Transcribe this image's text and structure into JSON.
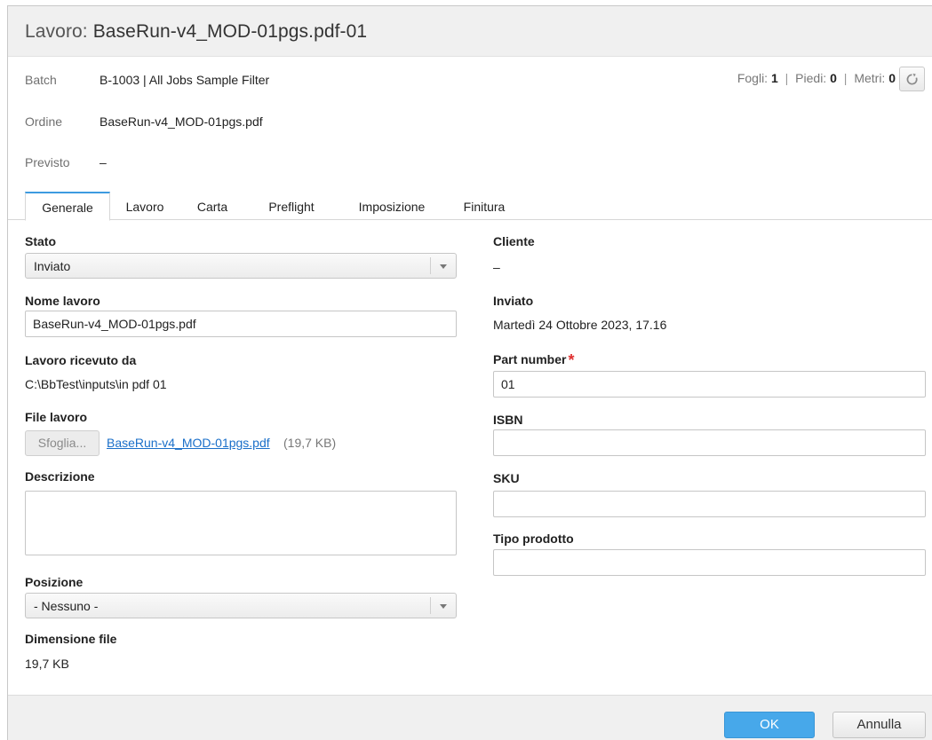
{
  "dialog": {
    "title_label": "Lavoro:",
    "title_value": "BaseRun-v4_MOD-01pgs.pdf-01"
  },
  "summary": {
    "batch_label": "Batch",
    "batch_value": "B-1003 | All Jobs Sample Filter",
    "order_label": "Ordine",
    "order_value": "BaseRun-v4_MOD-01pgs.pdf",
    "expected_label": "Previsto",
    "expected_value": "–"
  },
  "stats": {
    "sheets_label": "Fogli:",
    "sheets_value": "1",
    "feet_label": "Piedi:",
    "feet_value": "0",
    "meters_label": "Metri:",
    "meters_value": "0",
    "separator": "|"
  },
  "tabs": [
    {
      "label": "Generale",
      "active": true
    },
    {
      "label": "Lavoro",
      "active": false
    },
    {
      "label": "Carta",
      "active": false
    },
    {
      "label": "Preflight",
      "active": false
    },
    {
      "label": "Imposizione",
      "active": false
    },
    {
      "label": "Finitura",
      "active": false
    }
  ],
  "left": {
    "status_label": "Stato",
    "status_value": "Inviato",
    "job_name_label": "Nome lavoro",
    "job_name_value": "BaseRun-v4_MOD-01pgs.pdf",
    "received_from_label": "Lavoro ricevuto da",
    "received_from_value": "C:\\BbTest\\inputs\\in pdf 01",
    "job_file_label": "File lavoro",
    "browse_label": "Sfoglia...",
    "file_link": "BaseRun-v4_MOD-01pgs.pdf",
    "file_link_size": "(19,7 KB)",
    "description_label": "Descrizione",
    "description_value": "",
    "position_label": "Posizione",
    "position_value": "- Nessuno -",
    "file_size_label": "Dimensione file",
    "file_size_value": "19,7 KB"
  },
  "right": {
    "customer_label": "Cliente",
    "customer_value": "–",
    "submitted_label": "Inviato",
    "submitted_value": "Martedì 24 Ottobre 2023, 17.16",
    "part_number_label": "Part number",
    "part_number_required": "*",
    "part_number_value": "01",
    "isbn_label": "ISBN",
    "isbn_value": "",
    "sku_label": "SKU",
    "sku_value": "",
    "product_type_label": "Tipo prodotto",
    "product_type_value": ""
  },
  "footer": {
    "ok_label": "OK",
    "cancel_label": "Annulla"
  },
  "icons": {
    "refresh": "refresh-icon",
    "dropdown": "chevron-down-icon"
  },
  "colors": {
    "accent": "#47a8ea",
    "link": "#1a6fc9",
    "required": "#e03030",
    "tab_active_border": "#3d9be0"
  }
}
